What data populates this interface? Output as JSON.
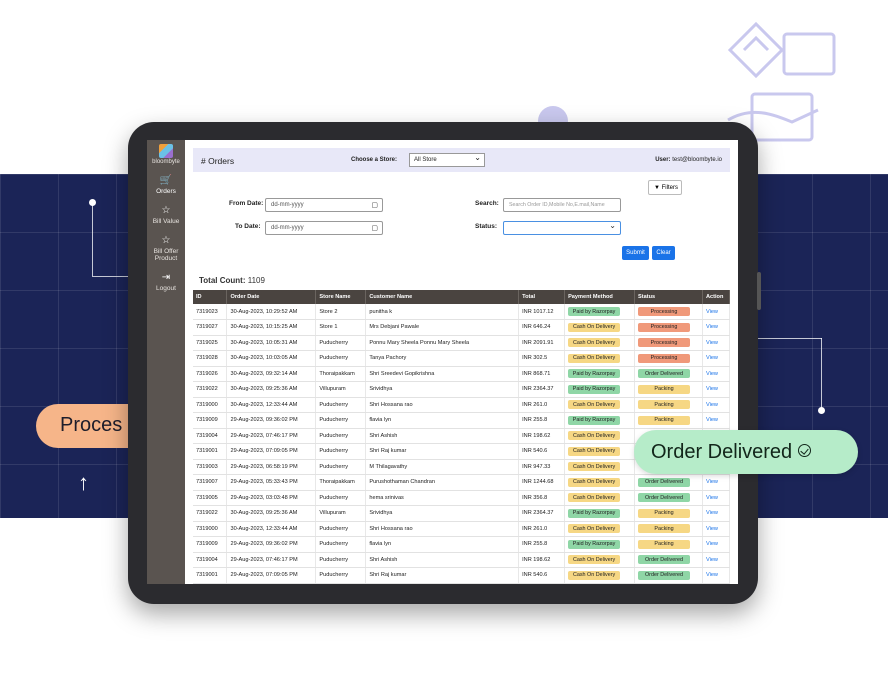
{
  "promo": {
    "process_label": "Proces",
    "delivered_label": "Order Delivered"
  },
  "sidebar": {
    "brand": "bloombyte",
    "items": [
      {
        "icon": "cart-icon",
        "glyph": "🛒",
        "label": "Orders"
      },
      {
        "icon": "star-icon",
        "glyph": "☆",
        "label": "Bill Value"
      },
      {
        "icon": "star-icon",
        "glyph": "☆",
        "label": "Bill Offer Product"
      },
      {
        "icon": "logout-icon",
        "glyph": "⇥",
        "label": "Logout"
      }
    ]
  },
  "header": {
    "title": "# Orders",
    "store_label": "Choose a Store:",
    "store_value": "All Store",
    "user_label": "User:",
    "user_value": "test@bloombyte.io"
  },
  "filters": {
    "filters_button": "Filters",
    "from_label": "From Date:",
    "from_value": "dd-mm-yyyy",
    "to_label": "To Date:",
    "to_value": "dd-mm-yyyy",
    "search_label": "Search:",
    "search_placeholder": "Search Order ID,Mobile No,E.mail,Name",
    "status_label": "Status:",
    "status_value": "",
    "submit_label": "Submit",
    "clear_label": "Clear"
  },
  "summary": {
    "count_label": "Total Count:",
    "count_value": "1109"
  },
  "table": {
    "columns": [
      "ID",
      "Order Date",
      "Store Name",
      "Customer Name",
      "Total",
      "Payment Method",
      "Status",
      "Action"
    ],
    "rows": [
      {
        "id": "7319023",
        "date": "30-Aug-2023, 10:29:52 AM",
        "store": "Store 2",
        "customer": "punitha k",
        "total": "INR 1017.12",
        "payment": "Paid by Razorpay",
        "pay_type": "r",
        "status": "Processing",
        "st_type": "proc",
        "action": "View"
      },
      {
        "id": "7319027",
        "date": "30-Aug-2023, 10:15:25 AM",
        "store": "Store 1",
        "customer": "Mrs Debjani Pawale",
        "total": "INR 646.24",
        "payment": "Cash On Delivery",
        "pay_type": "c",
        "status": "Processing",
        "st_type": "proc",
        "action": "View"
      },
      {
        "id": "7319025",
        "date": "30-Aug-2023, 10:05:31 AM",
        "store": "Puducherry",
        "customer": "Ponnu Mary Sheela Ponnu Mary Sheela",
        "total": "INR 2091.91",
        "payment": "Cash On Delivery",
        "pay_type": "c",
        "status": "Processing",
        "st_type": "proc",
        "action": "View"
      },
      {
        "id": "7319028",
        "date": "30-Aug-2023, 10:03:05 AM",
        "store": "Puducherry",
        "customer": "Tanya Pachory",
        "total": "INR 302.5",
        "payment": "Cash On Delivery",
        "pay_type": "c",
        "status": "Processing",
        "st_type": "proc",
        "action": "View"
      },
      {
        "id": "7319026",
        "date": "30-Aug-2023, 09:32:14 AM",
        "store": "Thoraipakkam",
        "customer": "Shri Sreedevi Gopikrishna",
        "total": "INR 868.71",
        "payment": "Paid by Razorpay",
        "pay_type": "r",
        "status": "Order Delivered",
        "st_type": "del",
        "action": "View"
      },
      {
        "id": "7319022",
        "date": "30-Aug-2023, 09:25:36 AM",
        "store": "Villupuram",
        "customer": "Srividhya",
        "total": "INR 2364.37",
        "payment": "Paid by Razorpay",
        "pay_type": "r",
        "status": "Packing",
        "st_type": "pack",
        "action": "View"
      },
      {
        "id": "7319000",
        "date": "30-Aug-2023, 12:33:44 AM",
        "store": "Puducherry",
        "customer": "Shri Hossana rao",
        "total": "INR 261.0",
        "payment": "Cash On Delivery",
        "pay_type": "c",
        "status": "Packing",
        "st_type": "pack",
        "action": "View"
      },
      {
        "id": "7319009",
        "date": "29-Aug-2023, 09:36:02 PM",
        "store": "Puducherry",
        "customer": "flavia lyn",
        "total": "INR 255.8",
        "payment": "Paid by Razorpay",
        "pay_type": "r",
        "status": "Packing",
        "st_type": "pack",
        "action": "View"
      },
      {
        "id": "7319004",
        "date": "29-Aug-2023, 07:46:17 PM",
        "store": "Puducherry",
        "customer": "Shri Ashish",
        "total": "INR 198.62",
        "payment": "Cash On Delivery",
        "pay_type": "c",
        "status": "",
        "st_type": "",
        "action": "View"
      },
      {
        "id": "7319001",
        "date": "29-Aug-2023, 07:09:05 PM",
        "store": "Puducherry",
        "customer": "Shri Raj kumar",
        "total": "INR 540.6",
        "payment": "Cash On Delivery",
        "pay_type": "c",
        "status": "",
        "st_type": "",
        "action": "View"
      },
      {
        "id": "7319003",
        "date": "29-Aug-2023, 06:58:19 PM",
        "store": "Puducherry",
        "customer": "M Thilagavathy",
        "total": "INR 947.33",
        "payment": "Cash On Delivery",
        "pay_type": "c",
        "status": "",
        "st_type": "",
        "action": "View"
      },
      {
        "id": "7319007",
        "date": "29-Aug-2023, 05:33:43 PM",
        "store": "Thoraipakkam",
        "customer": "Purushothaman Chandran",
        "total": "INR 1244.68",
        "payment": "Cash On Delivery",
        "pay_type": "c",
        "status": "Order Delivered",
        "st_type": "del",
        "action": "View"
      },
      {
        "id": "7319005",
        "date": "29-Aug-2023, 03:03:48 PM",
        "store": "Puducherry",
        "customer": "hema srinivas",
        "total": "INR 356.8",
        "payment": "Cash On Delivery",
        "pay_type": "c",
        "status": "Order Delivered",
        "st_type": "del",
        "action": "View"
      },
      {
        "id": "7319022",
        "date": "30-Aug-2023, 09:25:36 AM",
        "store": "Villupuram",
        "customer": "Srividhya",
        "total": "INR 2364.37",
        "payment": "Paid by Razorpay",
        "pay_type": "r",
        "status": "Packing",
        "st_type": "pack",
        "action": "View"
      },
      {
        "id": "7319000",
        "date": "30-Aug-2023, 12:33:44 AM",
        "store": "Puducherry",
        "customer": "Shri Hossana rao",
        "total": "INR 261.0",
        "payment": "Cash On Delivery",
        "pay_type": "c",
        "status": "Packing",
        "st_type": "pack",
        "action": "View"
      },
      {
        "id": "7319009",
        "date": "29-Aug-2023, 09:36:02 PM",
        "store": "Puducherry",
        "customer": "flavia lyn",
        "total": "INR 255.8",
        "payment": "Paid by Razorpay",
        "pay_type": "r",
        "status": "Packing",
        "st_type": "pack",
        "action": "View"
      },
      {
        "id": "7319004",
        "date": "29-Aug-2023, 07:46:17 PM",
        "store": "Puducherry",
        "customer": "Shri Ashish",
        "total": "INR 198.62",
        "payment": "Cash On Delivery",
        "pay_type": "c",
        "status": "Order Delivered",
        "st_type": "del",
        "action": "View"
      },
      {
        "id": "7319001",
        "date": "29-Aug-2023, 07:09:05 PM",
        "store": "Puducherry",
        "customer": "Shri Raj kumar",
        "total": "INR 540.6",
        "payment": "Cash On Delivery",
        "pay_type": "c",
        "status": "Order Delivered",
        "st_type": "del",
        "action": "View"
      }
    ]
  },
  "colors": {
    "banner": "#1b2457",
    "primary_button": "#1a73e8",
    "razorpay": "#8fd6a6",
    "cod": "#f6d784",
    "processing": "#f0997a",
    "delivered": "#8fd6a6"
  }
}
